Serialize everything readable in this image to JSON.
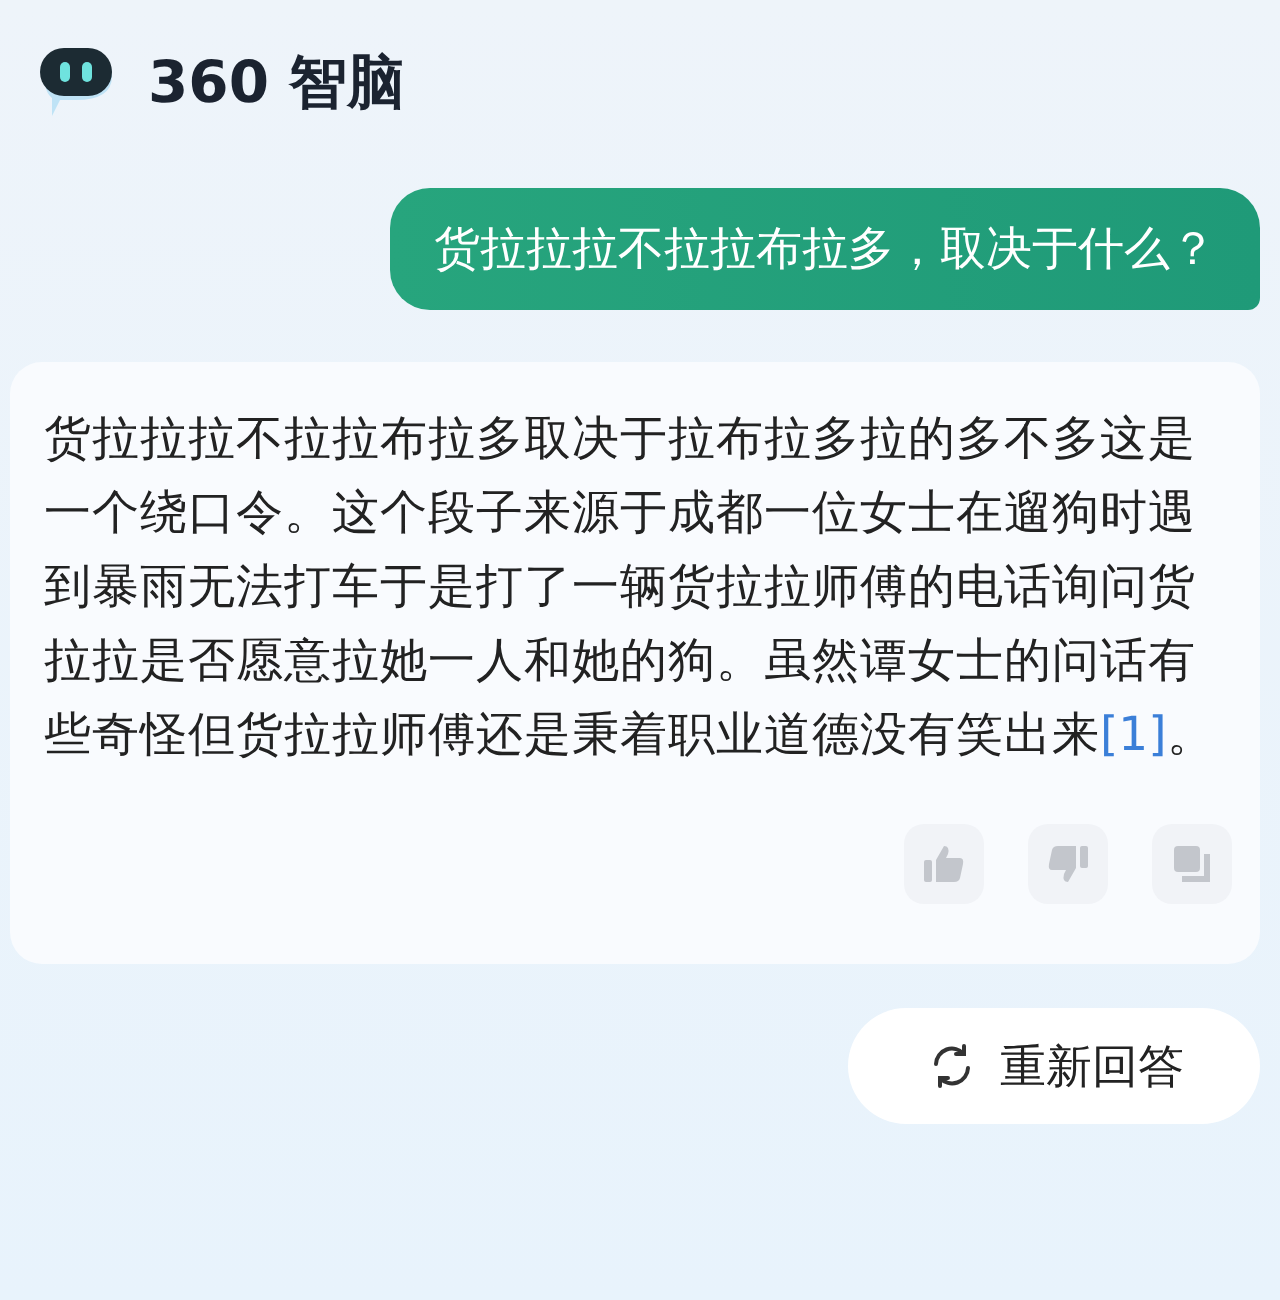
{
  "header": {
    "title": "360 智脑"
  },
  "question": {
    "text": "货拉拉拉不拉拉布拉多，取决于什么？"
  },
  "answer": {
    "text": "货拉拉拉不拉拉布拉多取决于拉布拉多拉的多不多这是一个绕口令。这个段子来源于成都一位女士在遛狗时遇到暴雨无法打车于是打了一辆货拉拉师傅的电话询问货拉拉是否愿意拉她一人和她的狗。虽然谭女士的问话有些奇怪但货拉拉师傅还是秉着职业道德没有笑出来",
    "citation": "[1]",
    "end": "。",
    "actions": [
      {
        "kind": "like"
      },
      {
        "kind": "dislike"
      },
      {
        "kind": "copy"
      }
    ]
  },
  "regenerate": {
    "label": "重新回答"
  }
}
